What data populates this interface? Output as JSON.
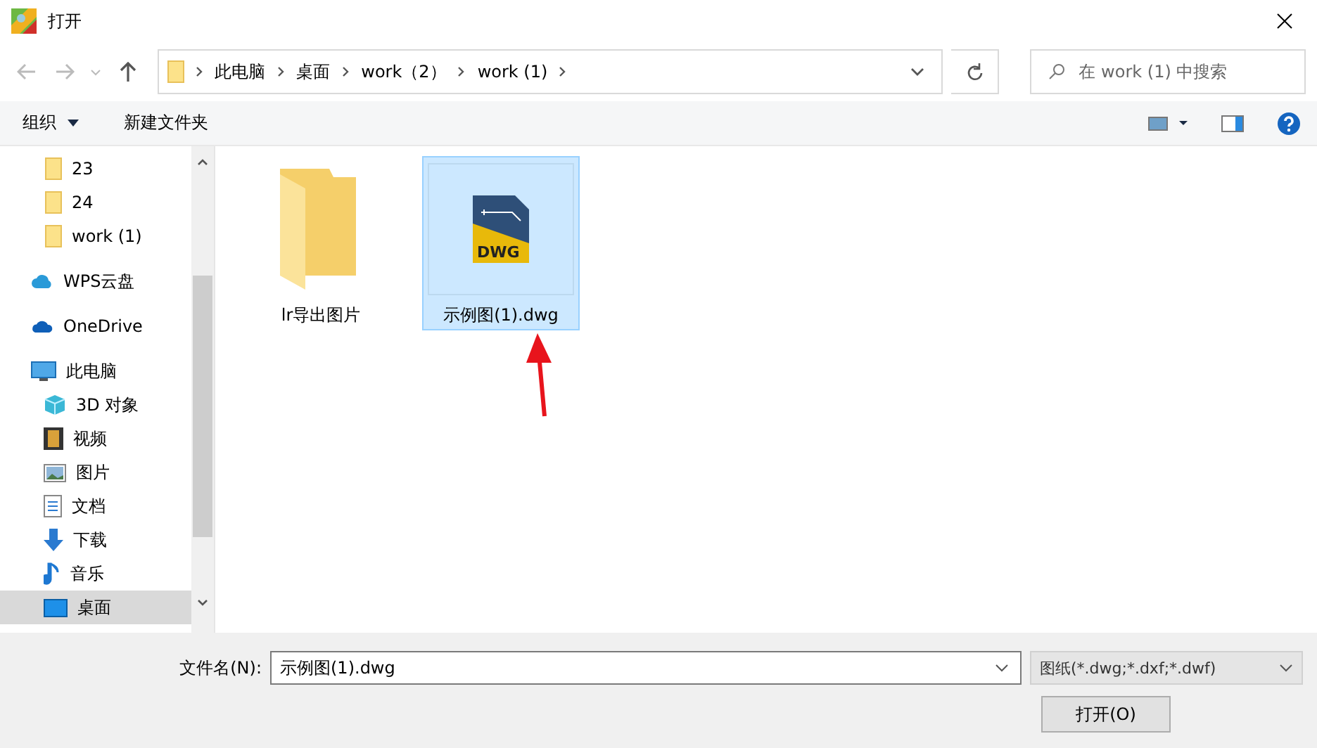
{
  "window": {
    "title": "打开"
  },
  "address": {
    "crumbs": [
      "此电脑",
      "桌面",
      "work（2）",
      "work (1)"
    ]
  },
  "search": {
    "placeholder": "在 work (1) 中搜索"
  },
  "toolbar": {
    "organize": "组织",
    "new_folder": "新建文件夹"
  },
  "sidebar": {
    "items": [
      {
        "label": "23",
        "kind": "folder",
        "selected": false
      },
      {
        "label": "24",
        "kind": "folder",
        "selected": false
      },
      {
        "label": "work (1)",
        "kind": "folder",
        "selected": false
      },
      {
        "label": "WPS云盘",
        "kind": "cloud",
        "selected": false
      },
      {
        "label": "OneDrive",
        "kind": "onedrive",
        "selected": false
      },
      {
        "label": "此电脑",
        "kind": "pc",
        "selected": false,
        "children": [
          {
            "label": "3D 对象",
            "kind": "cube",
            "selected": false
          },
          {
            "label": "视频",
            "kind": "video",
            "selected": false
          },
          {
            "label": "图片",
            "kind": "picture",
            "selected": false
          },
          {
            "label": "文档",
            "kind": "document",
            "selected": false
          },
          {
            "label": "下载",
            "kind": "download",
            "selected": false
          },
          {
            "label": "音乐",
            "kind": "music",
            "selected": false
          },
          {
            "label": "桌面",
            "kind": "desktop",
            "selected": true
          }
        ]
      }
    ]
  },
  "files": [
    {
      "name": "lr导出图片",
      "kind": "folder",
      "selected": false
    },
    {
      "name": "示例图(1).dwg",
      "kind": "dwg",
      "selected": true,
      "icon_text": "DWG"
    }
  ],
  "footer": {
    "filename_label": "文件名(N):",
    "filename": "示例图(1).dwg",
    "filetype": "图纸(*.dwg;*.dxf;*.dwf)",
    "open_button": "打开(O)"
  }
}
